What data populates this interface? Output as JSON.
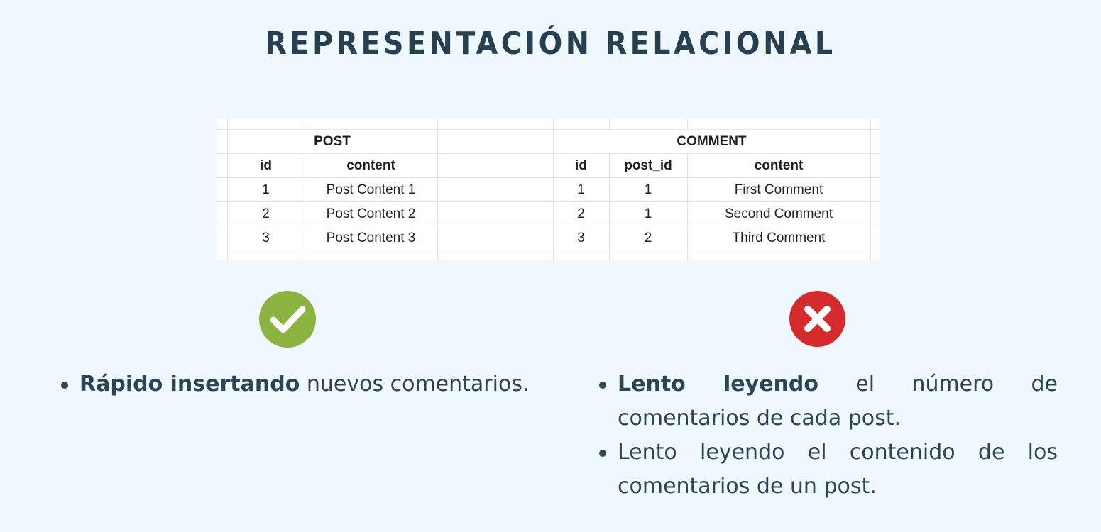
{
  "title": "REPRESENTACIÓN RELACIONAL",
  "post_table": {
    "name": "POST",
    "columns": [
      "id",
      "content"
    ],
    "rows": [
      [
        "1",
        "Post Content 1"
      ],
      [
        "2",
        "Post Content 2"
      ],
      [
        "3",
        "Post Content 3"
      ]
    ]
  },
  "comment_table": {
    "name": "COMMENT",
    "columns": [
      "id",
      "post_id",
      "content"
    ],
    "rows": [
      [
        "1",
        "1",
        "First Comment"
      ],
      [
        "2",
        "1",
        "Second Comment"
      ],
      [
        "3",
        "2",
        "Third Comment"
      ]
    ]
  },
  "icons": {
    "pro": "check-circle-icon",
    "con": "x-circle-icon",
    "pro_color": "#8bb33f",
    "con_color": "#d52b2b"
  },
  "pros": [
    {
      "bold": "Rápido insertando",
      "text": " nuevos comentarios."
    }
  ],
  "cons": [
    {
      "bold": "Lento leyendo",
      "text": " el número de comentarios de cada post."
    },
    {
      "bold": "",
      "text": "Lento leyendo el contenido de los comentarios de un post."
    }
  ]
}
